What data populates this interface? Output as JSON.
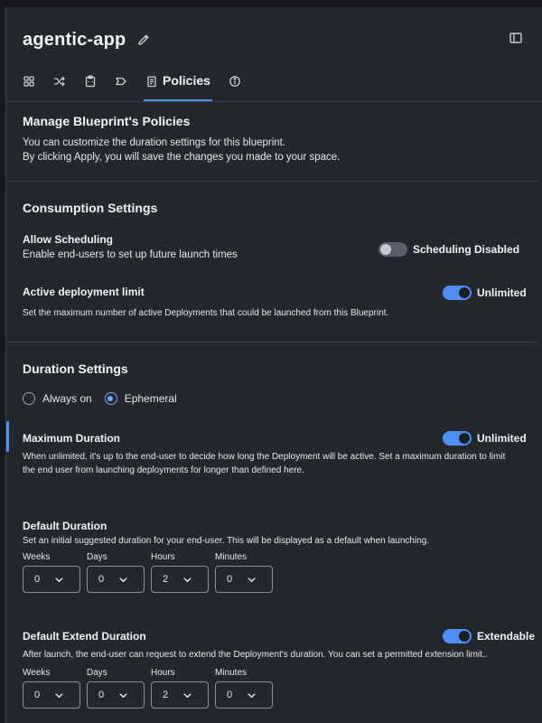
{
  "header": {
    "app_name": "agentic-app",
    "icons": [
      "pencil-icon",
      "sidebar-panel-icon"
    ]
  },
  "tabs": {
    "items": [
      {
        "icon": "grid-icon",
        "label": ""
      },
      {
        "icon": "shuffle-icon",
        "label": ""
      },
      {
        "icon": "clipboard-icon",
        "label": ""
      },
      {
        "icon": "tag-icon",
        "label": ""
      },
      {
        "icon": "policy-document-icon",
        "label": "Policies",
        "active": true
      },
      {
        "icon": "info-icon",
        "label": ""
      }
    ]
  },
  "manage": {
    "title": "Manage Blueprint's Policies",
    "line1": "You can customize the duration settings for this blueprint.",
    "line2": "By clicking Apply, you will save the changes you made to your space."
  },
  "consumption": {
    "title": "Consumption Settings",
    "scheduling": {
      "label": "Allow Scheduling",
      "description": "Enable end-users to set up future launch times",
      "toggle_label": "Scheduling Disabled",
      "enabled": false
    },
    "deployment_limit": {
      "label": "Active deployment limit",
      "description": "Set the maximum number of active Deployments that could be launched from this Blueprint.",
      "toggle_label": "Unlimited",
      "enabled": true
    }
  },
  "duration": {
    "title": "Duration Settings",
    "radio": {
      "always_on": "Always on",
      "ephemeral": "Ephemeral",
      "selected": "ephemeral"
    },
    "max_duration": {
      "label": "Maximum Duration",
      "description": "When unlimited, it's up to the end-user to decide how long the Deployment will be active. Set a maximum duration to limit the end user from launching deployments for longer than defined here.",
      "toggle_label": "Unlimited",
      "enabled": true
    },
    "default_duration": {
      "label": "Default Duration",
      "description": "Set an initial suggested duration for your end-user. This will be displayed as a default when launching.",
      "fields": [
        {
          "label": "Weeks",
          "value": "0"
        },
        {
          "label": "Days",
          "value": "0"
        },
        {
          "label": "Hours",
          "value": "2"
        },
        {
          "label": "Minutes",
          "value": "0"
        }
      ]
    },
    "extend_duration": {
      "label": "Default Extend Duration",
      "description": "After launch, the end-user can request to extend the Deployment's duration. You can set a permitted extension limit..",
      "toggle_label": "Extendable",
      "enabled": true,
      "fields": [
        {
          "label": "Weeks",
          "value": "0"
        },
        {
          "label": "Days",
          "value": "0"
        },
        {
          "label": "Hours",
          "value": "2"
        },
        {
          "label": "Minutes",
          "value": "0"
        }
      ]
    }
  },
  "colors": {
    "accent": "#4f8ef7",
    "panel": "#24272c",
    "background": "#16181c"
  }
}
